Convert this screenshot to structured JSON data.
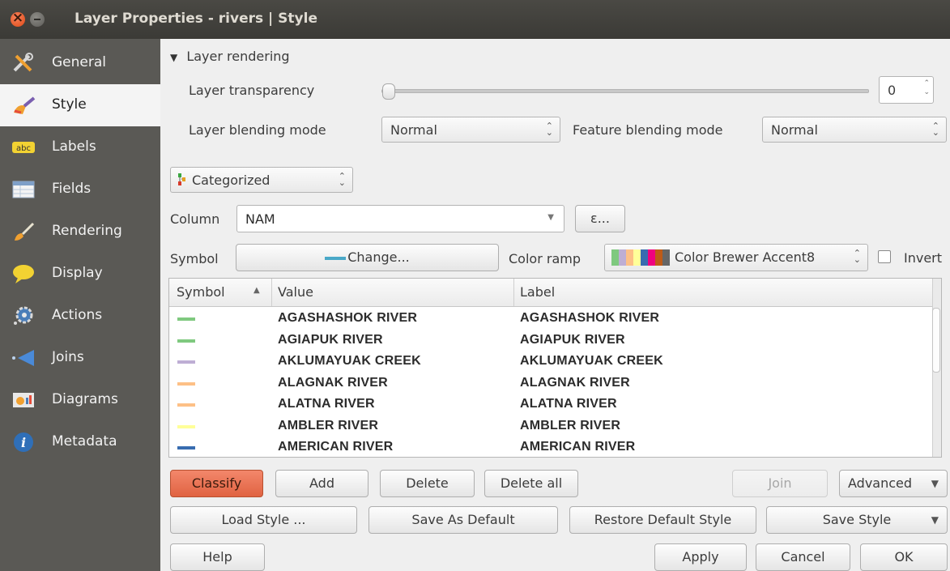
{
  "window": {
    "title": "Layer Properties - rivers | Style"
  },
  "sidebar": {
    "items": [
      {
        "label": "General",
        "icon": "tools-icon"
      },
      {
        "label": "Style",
        "icon": "brush-icon"
      },
      {
        "label": "Labels",
        "icon": "abc-label-icon"
      },
      {
        "label": "Fields",
        "icon": "table-icon"
      },
      {
        "label": "Rendering",
        "icon": "paintbrush-icon"
      },
      {
        "label": "Display",
        "icon": "speech-bubble-icon"
      },
      {
        "label": "Actions",
        "icon": "gear-icon"
      },
      {
        "label": "Joins",
        "icon": "join-arrow-icon"
      },
      {
        "label": "Diagrams",
        "icon": "diagram-icon"
      },
      {
        "label": "Metadata",
        "icon": "info-icon"
      }
    ],
    "active": "Style"
  },
  "rendering": {
    "section_label": "Layer rendering",
    "transparency_label": "Layer transparency",
    "transparency_value": "0",
    "layer_blending_label": "Layer blending mode",
    "layer_blending_value": "Normal",
    "feature_blending_label": "Feature blending mode",
    "feature_blending_value": "Normal"
  },
  "renderer": {
    "type": "Categorized"
  },
  "column": {
    "label": "Column",
    "value": "NAM",
    "expression_button": "ε..."
  },
  "symbol": {
    "label": "Symbol",
    "change_button": "Change..."
  },
  "color_ramp": {
    "label": "Color ramp",
    "value": "Color Brewer Accent8",
    "invert_label": "Invert"
  },
  "table": {
    "headers": {
      "symbol": "Symbol",
      "value": "Value",
      "label": "Label"
    },
    "rows": [
      {
        "color": "#7fc97f",
        "value": "AGASHASHOK RIVER",
        "label": "AGASHASHOK RIVER"
      },
      {
        "color": "#7fc97f",
        "value": "AGIAPUK RIVER",
        "label": "AGIAPUK RIVER"
      },
      {
        "color": "#beaed4",
        "value": "AKLUMAYUAK CREEK",
        "label": "AKLUMAYUAK CREEK"
      },
      {
        "color": "#fdc086",
        "value": "ALAGNAK RIVER",
        "label": "ALAGNAK RIVER"
      },
      {
        "color": "#fdc086",
        "value": "ALATNA RIVER",
        "label": "ALATNA RIVER"
      },
      {
        "color": "#ffff99",
        "value": "AMBLER RIVER",
        "label": "AMBLER RIVER"
      },
      {
        "color": "#386cb0",
        "value": "AMERICAN RIVER",
        "label": "AMERICAN RIVER"
      }
    ]
  },
  "actions": {
    "classify": "Classify",
    "add": "Add",
    "delete": "Delete",
    "delete_all": "Delete all",
    "join": "Join",
    "advanced": "Advanced"
  },
  "style_buttons": {
    "load": "Load Style ...",
    "save_default": "Save As Default",
    "restore_default": "Restore Default Style",
    "save_style": "Save Style"
  },
  "dialog_buttons": {
    "help": "Help",
    "apply": "Apply",
    "cancel": "Cancel",
    "ok": "OK"
  },
  "colors": {
    "accent": "#e06342",
    "sidebar": "#5a5955",
    "titlebar": "#3b3a36"
  }
}
